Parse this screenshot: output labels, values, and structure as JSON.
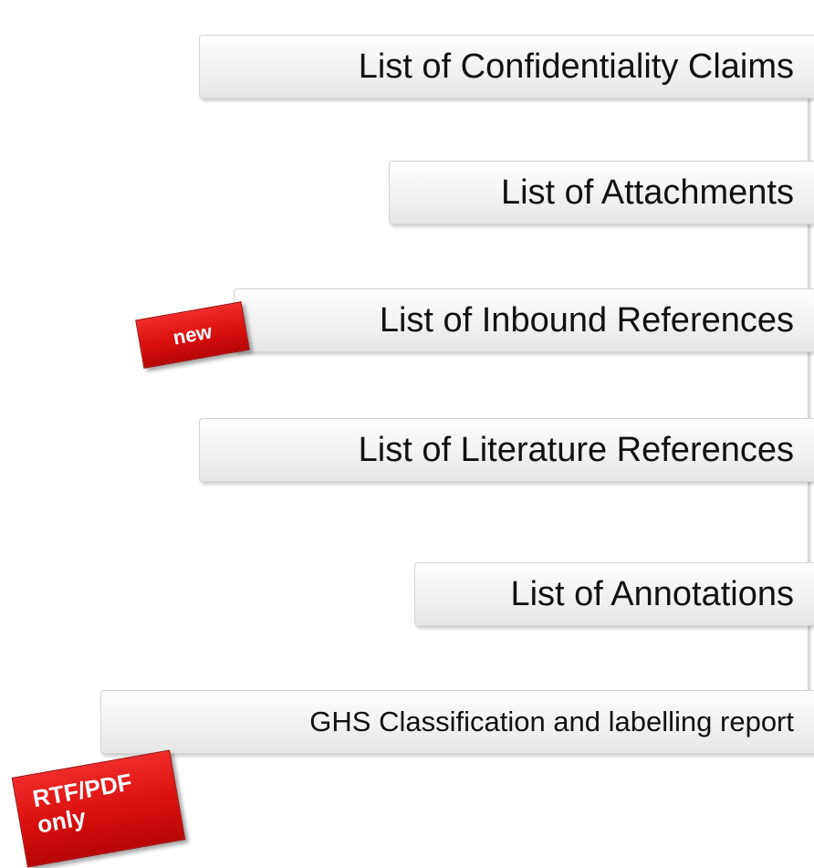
{
  "items": [
    {
      "label": "List of Confidentiality Claims"
    },
    {
      "label": "List of Attachments"
    },
    {
      "label": "List of Inbound References"
    },
    {
      "label": "List of Literature References"
    },
    {
      "label": "List of Annotations"
    },
    {
      "label": "GHS Classification and labelling report"
    }
  ],
  "badges": {
    "new": "new",
    "rtf_line1": "RTF/PDF",
    "rtf_line2": "only"
  },
  "colors": {
    "badge_red": "#d80f0f",
    "box_bg": "#f4f4f4",
    "text": "#111111"
  }
}
